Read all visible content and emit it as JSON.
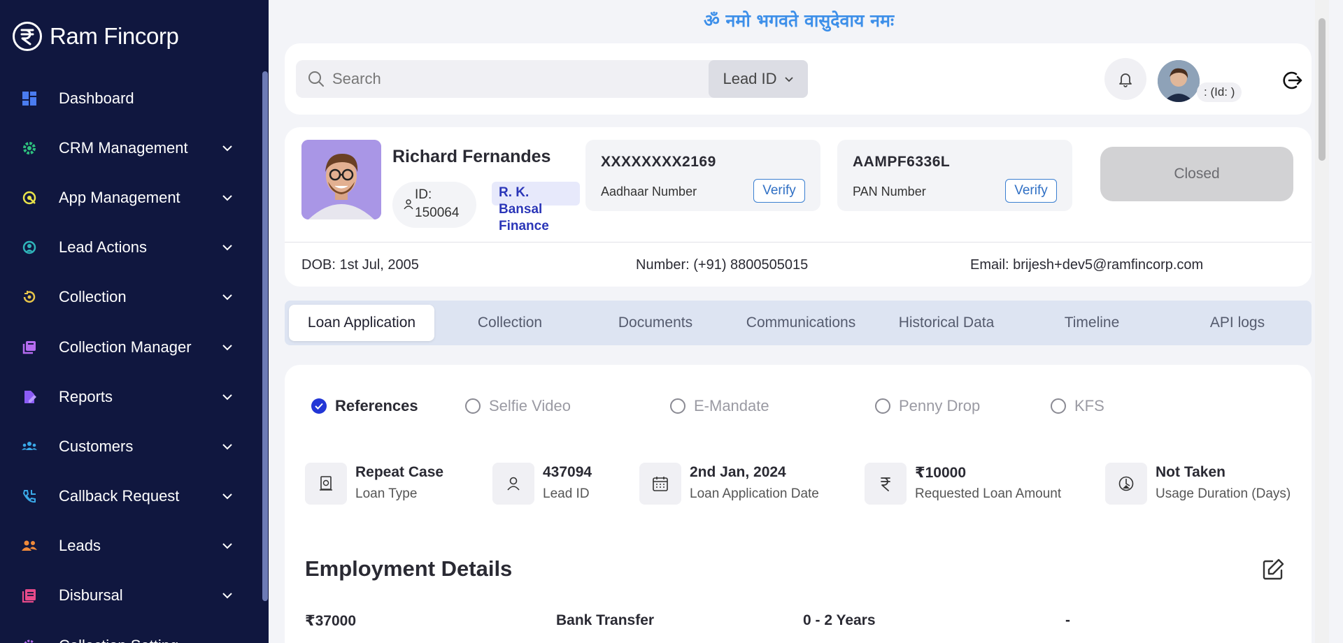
{
  "brand": {
    "name": "Ram Fincorp"
  },
  "sidebar": {
    "items": [
      {
        "label": "Dashboard",
        "icon": "dashboard-icon",
        "color": "#4a7cf0",
        "expandable": false
      },
      {
        "label": "CRM Management",
        "icon": "gear-icon",
        "color": "#2ec27e",
        "expandable": true
      },
      {
        "label": "App Management",
        "icon": "app-icon",
        "color": "#e8e34a",
        "expandable": true
      },
      {
        "label": "Lead Actions",
        "icon": "lead-actions-icon",
        "color": "#2fb4b9",
        "expandable": true
      },
      {
        "label": "Collection",
        "icon": "collection-icon",
        "color": "#e8c64a",
        "expandable": true
      },
      {
        "label": "Collection Manager",
        "icon": "collection-manager-icon",
        "color": "#b56cf0",
        "expandable": true
      },
      {
        "label": "Reports",
        "icon": "reports-icon",
        "color": "#8b5cf6",
        "expandable": true
      },
      {
        "label": "Customers",
        "icon": "customers-icon",
        "color": "#3aa9e8",
        "expandable": true
      },
      {
        "label": "Callback Request",
        "icon": "phone-icon",
        "color": "#3aa9e8",
        "expandable": true
      },
      {
        "label": "Leads",
        "icon": "leads-icon",
        "color": "#f08a3a",
        "expandable": true
      },
      {
        "label": "Disbursal",
        "icon": "disbursal-icon",
        "color": "#e84a8a",
        "expandable": true
      },
      {
        "label": "Collection Setting",
        "icon": "collection-setting-icon",
        "color": "#b56cf0",
        "expandable": true
      }
    ]
  },
  "header": {
    "mantra": "ॐ नमो भगवते वासुदेवाय नमः",
    "search_placeholder": "Search",
    "search_type": "Lead ID",
    "user_id_label": ": (Id: )"
  },
  "profile": {
    "name": "Richard Fernandes",
    "id_label": "ID:",
    "id_value": "150064",
    "company_line1": "R. K. Bansal",
    "company_line2": "Finance",
    "aadhaar_value": "XXXXXXXX2169",
    "aadhaar_label": "Aadhaar Number",
    "pan_value": "AAMPF6336L",
    "pan_label": "PAN Number",
    "verify_label": "Verify",
    "status": "Closed",
    "dob": "DOB: 1st Jul, 2005",
    "number": "Number: (+91) 8800505015",
    "email": "Email: brijesh+dev5@ramfincorp.com"
  },
  "tabs": [
    "Loan Application",
    "Collection",
    "Documents",
    "Communications",
    "Historical Data",
    "Timeline",
    "API logs"
  ],
  "steps": [
    {
      "label": "References",
      "done": true
    },
    {
      "label": "Selfie Video",
      "done": false
    },
    {
      "label": "E-Mandate",
      "done": false
    },
    {
      "label": "Penny Drop",
      "done": false
    },
    {
      "label": "KFS",
      "done": false
    }
  ],
  "loan_info": [
    {
      "value": "Repeat Case",
      "label": "Loan Type",
      "icon": "money-icon"
    },
    {
      "value": "437094",
      "label": "Lead ID",
      "icon": "user-icon"
    },
    {
      "value": "2nd Jan, 2024",
      "label": "Loan Application Date",
      "icon": "calendar-icon"
    },
    {
      "value": "₹10000",
      "label": "Requested Loan Amount",
      "icon": "rupee-icon"
    },
    {
      "value": "Not Taken",
      "label": "Usage Duration (Days)",
      "icon": "timer-icon"
    }
  ],
  "employment": {
    "title": "Employment Details",
    "values": [
      "₹37000",
      "Bank Transfer",
      "0 - 2 Years",
      "-"
    ]
  }
}
